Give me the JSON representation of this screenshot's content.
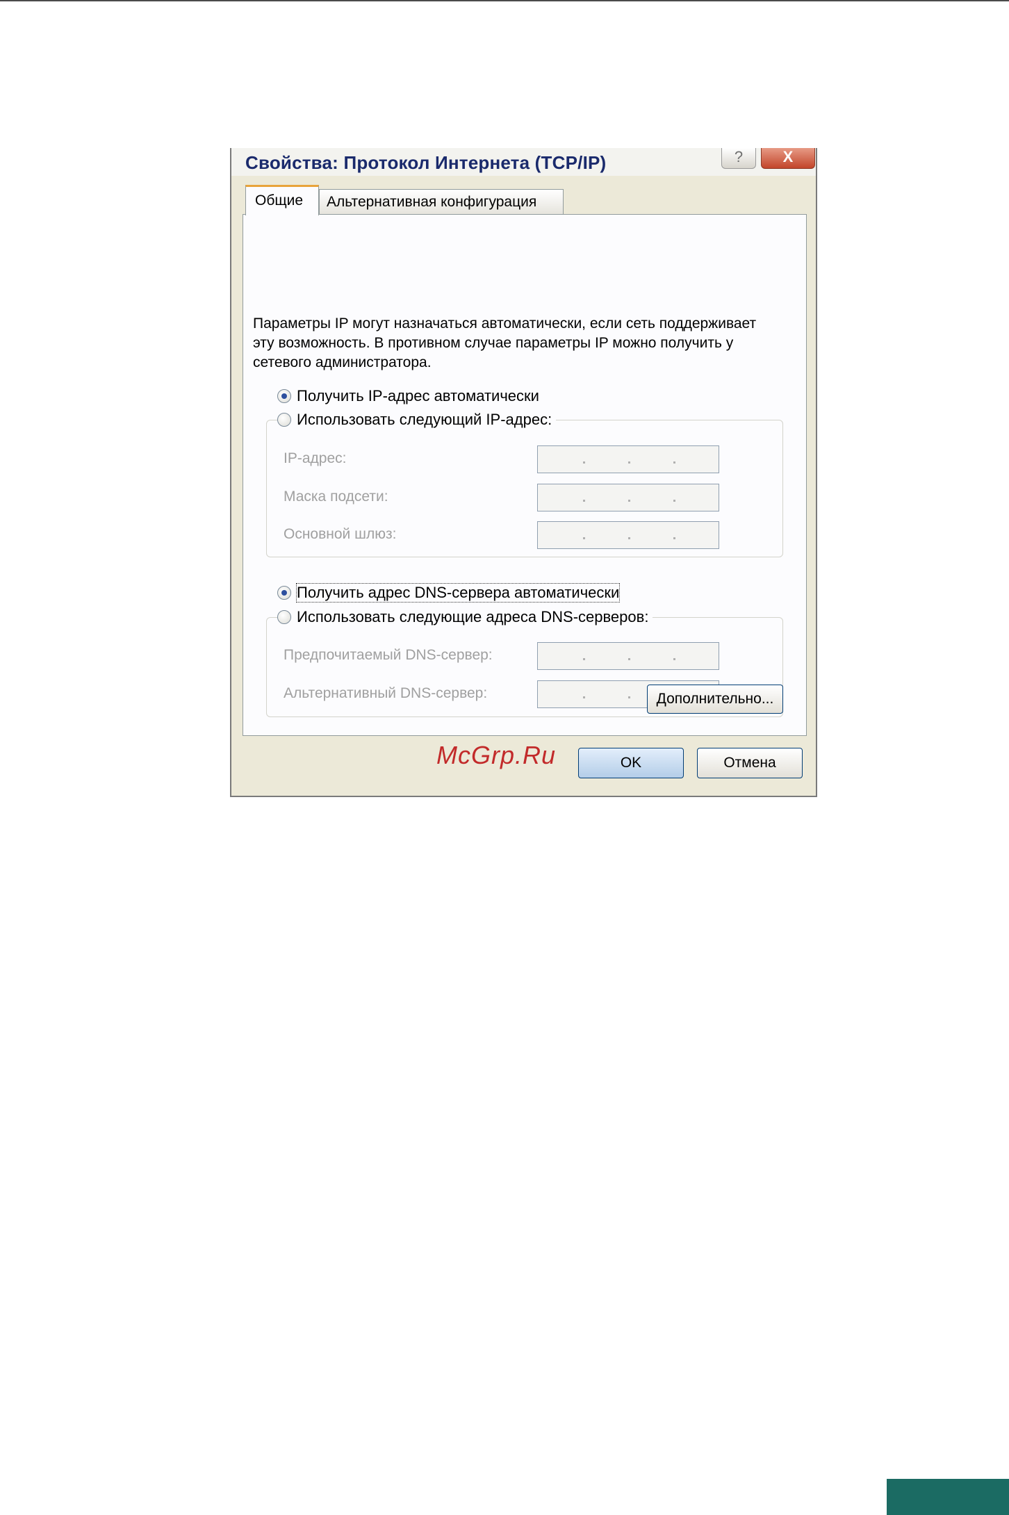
{
  "window": {
    "title": "Свойства: Протокол Интернета (TCP/IP)",
    "help_glyph": "?",
    "close_glyph": "X"
  },
  "tabs": [
    {
      "label": "Общие",
      "active": true
    },
    {
      "label": "Альтернативная конфигурация",
      "active": false
    }
  ],
  "general": {
    "description": "Параметры IP могут назначаться автоматически, если сеть поддерживает эту возможность. В противном случае параметры IP можно получить у сетевого администратора.",
    "ip_mode": {
      "auto_label": "Получить IP-адрес автоматически",
      "manual_label": "Использовать следующий IP-адрес:",
      "selected": "auto"
    },
    "ip_fields": [
      {
        "label": "IP-адрес:",
        "value": ""
      },
      {
        "label": "Маска подсети:",
        "value": ""
      },
      {
        "label": "Основной шлюз:",
        "value": ""
      }
    ],
    "dns_mode": {
      "auto_label": "Получить адрес DNS-сервера автоматически",
      "manual_label": "Использовать следующие адреса DNS-серверов:",
      "selected": "auto"
    },
    "dns_fields": [
      {
        "label": "Предпочитаемый DNS-сервер:",
        "value": ""
      },
      {
        "label": "Альтернативный DNS-сервер:",
        "value": ""
      }
    ],
    "advanced_label": "Дополнительно..."
  },
  "footer": {
    "ok_label": "OK",
    "cancel_label": "Отмена"
  },
  "watermark": "McGrp.Ru",
  "colors": {
    "title_text": "#1a2a6c",
    "close_button": "#c2452a",
    "active_tab_accent": "#e8a33b",
    "page_tab": "#1b6b63",
    "disabled_text": "#a0a0a0"
  }
}
